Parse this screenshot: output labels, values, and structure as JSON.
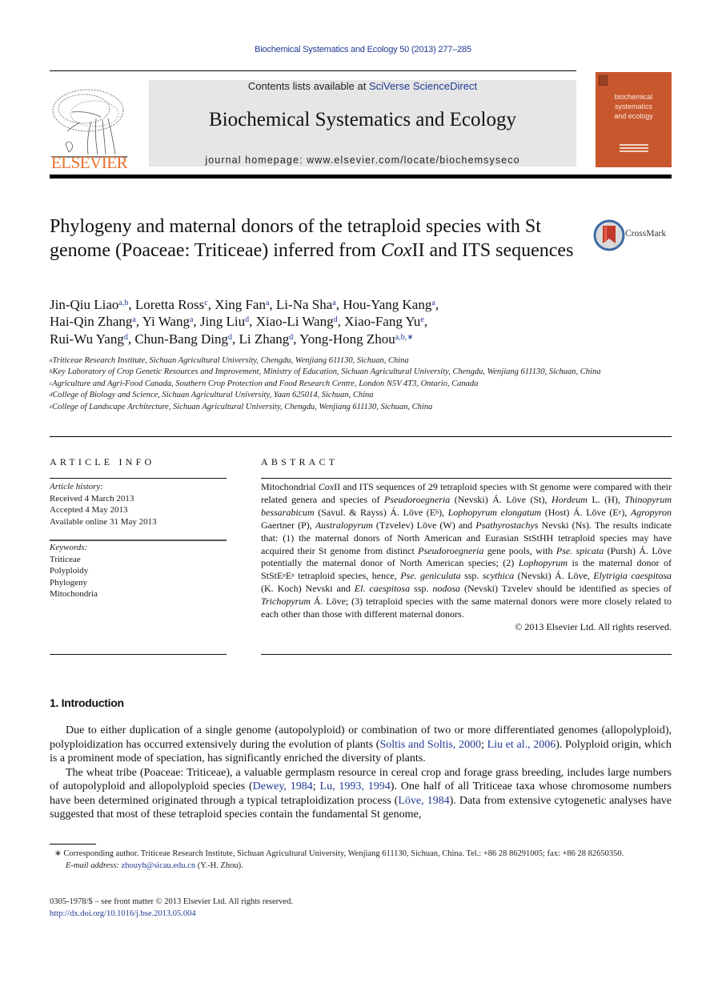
{
  "header": {
    "citation": "Biochemical Systematics and Ecology 50 (2013) 277–285",
    "publisher_logo_text": "ELSEVIER",
    "contents_prefix": "Contents lists available at ",
    "contents_link": "SciVerse ScienceDirect",
    "journal_title": "Biochemical Systematics and Ecology",
    "homepage_label": "journal homepage: www.elsevier.com/locate/biochemsyseco",
    "cover_title_lines": [
      "biochemical",
      "systematics",
      "and ecology"
    ],
    "brand_color": "#e8712c",
    "cover_color": "#c8572e",
    "link_color": "#1f3a93"
  },
  "article": {
    "title_part1": "Phylogeny and maternal donors of the tetraploid species with St genome (Poaceae: Triticeae) inferred from ",
    "title_italic": "Cox",
    "title_part2": "II and ITS sequences",
    "crossmark_label": "CrossMark",
    "authors": [
      {
        "name": "Jin-Qiu Liao",
        "aff": "a,b"
      },
      {
        "name": "Loretta Ross",
        "aff": "c"
      },
      {
        "name": "Xing Fan",
        "aff": "a"
      },
      {
        "name": "Li-Na Sha",
        "aff": "a"
      },
      {
        "name": "Hou-Yang Kang",
        "aff": "a"
      },
      {
        "name": "Hai-Qin Zhang",
        "aff": "a"
      },
      {
        "name": "Yi Wang",
        "aff": "a"
      },
      {
        "name": "Jing Liu",
        "aff": "d"
      },
      {
        "name": "Xiao-Li Wang",
        "aff": "d"
      },
      {
        "name": "Xiao-Fang Yu",
        "aff": "e"
      },
      {
        "name": "Rui-Wu Yang",
        "aff": "d"
      },
      {
        "name": "Chun-Bang Ding",
        "aff": "d"
      },
      {
        "name": "Li Zhang",
        "aff": "d"
      },
      {
        "name": "Yong-Hong Zhou",
        "aff": "a,b,∗"
      }
    ],
    "affiliations": [
      {
        "key": "a",
        "text": "Triticeae Research Institute, Sichuan Agricultural University, Chengdu, Wenjiang 611130, Sichuan, China"
      },
      {
        "key": "b",
        "text": "Key Laboratory of Crop Genetic Resources and Improvement, Ministry of Education, Sichuan Agricultural University, Chengdu, Wenjiang 611130, Sichuan, China"
      },
      {
        "key": "c",
        "text": "Agriculture and Agri-Food Canada, Southern Crop Protection and Food Research Centre, London N5V 4T3, Ontario, Canada"
      },
      {
        "key": "d",
        "text": "College of Biology and Science, Sichuan Agricultural University, Yaan 625014, Sichuan, China"
      },
      {
        "key": "e",
        "text": "College of Landscape Architecture, Sichuan Agricultural University, Chengdu, Wenjiang 611130, Sichuan, China"
      }
    ]
  },
  "article_info": {
    "heading": "ARTICLE INFO",
    "history_label": "Article history:",
    "received": "Received 4 March 2013",
    "accepted": "Accepted 4 May 2013",
    "online": "Available online 31 May 2013",
    "keywords_label": "Keywords:",
    "keywords": [
      "Triticeae",
      "Polyploidy",
      "Phylogeny",
      "Mitochondria"
    ]
  },
  "abstract": {
    "heading": "ABSTRACT",
    "segments": [
      {
        "t": "Mitochondrial "
      },
      {
        "t": "Cox",
        "i": true
      },
      {
        "t": "II and ITS sequences of 29 tetraploid species with St genome were compared with their related genera and species of "
      },
      {
        "t": "Pseudoroegneria",
        "i": true
      },
      {
        "t": " (Nevski) Á. Löve (St), "
      },
      {
        "t": "Hordeum",
        "i": true
      },
      {
        "t": " L. (H), "
      },
      {
        "t": "Thinopyrum bessarabicum",
        "i": true
      },
      {
        "t": " (Savul. & Rayss) Á. Löve (E"
      },
      {
        "t": "b",
        "sup": true
      },
      {
        "t": "), "
      },
      {
        "t": "Lophopyrum elongatum",
        "i": true
      },
      {
        "t": " (Host) Á. Löve (E"
      },
      {
        "t": "e",
        "sup": true
      },
      {
        "t": "), "
      },
      {
        "t": "Agropyron",
        "i": true
      },
      {
        "t": " Gaertner (P), "
      },
      {
        "t": "Australopyrum",
        "i": true
      },
      {
        "t": " (Tzvelev) Löve (W) and "
      },
      {
        "t": "Psathyrostachys",
        "i": true
      },
      {
        "t": " Nevski (Ns). The results indicate that: (1) the maternal donors of North American and Eurasian StStHH tetraploid species may have acquired their St genome from distinct "
      },
      {
        "t": "Pseudoroegneria",
        "i": true
      },
      {
        "t": " gene pools, with "
      },
      {
        "t": "Pse. spicata",
        "i": true
      },
      {
        "t": " (Pursh) Á. Löve potentially the maternal donor of North American species; (2) "
      },
      {
        "t": "Lophopyrum",
        "i": true
      },
      {
        "t": " is the maternal donor of StStE"
      },
      {
        "t": "e",
        "sup": true
      },
      {
        "t": "E"
      },
      {
        "t": "e",
        "sup": true
      },
      {
        "t": " tetraploid species, hence, "
      },
      {
        "t": "Pse. geniculata",
        "i": true
      },
      {
        "t": " ssp. "
      },
      {
        "t": "scythica",
        "i": true
      },
      {
        "t": " (Nevski) Á. Löve, "
      },
      {
        "t": "Elytrigia caespitosa",
        "i": true
      },
      {
        "t": " (K. Koch) Nevski and "
      },
      {
        "t": "El. caespitosa",
        "i": true
      },
      {
        "t": " ssp. "
      },
      {
        "t": "nodosa",
        "i": true
      },
      {
        "t": " (Nevski) Tzvelev should be identified as species of "
      },
      {
        "t": "Trichopyrum",
        "i": true
      },
      {
        "t": " Á. Löve; (3) tetraploid species with the same maternal donors were more closely related to each other than those with different maternal donors."
      }
    ],
    "copyright": "© 2013 Elsevier Ltd. All rights reserved."
  },
  "introduction": {
    "heading": "1.  Introduction",
    "paragraphs": [
      [
        {
          "t": "Due to either duplication of a single genome (autopolyploid) or combination of two or more differentiated genomes (allopolyploid), polyploidization has occurred extensively during the evolution of plants ("
        },
        {
          "t": "Soltis and Soltis, 2000",
          "link": true
        },
        {
          "t": "; "
        },
        {
          "t": "Liu et al., 2006",
          "link": true
        },
        {
          "t": "). Polyploid origin, which is a prominent mode of speciation, has significantly enriched the diversity of plants."
        }
      ],
      [
        {
          "t": "The wheat tribe (Poaceae: Triticeae), a valuable germplasm resource in cereal crop and forage grass breeding, includes large numbers of autopolyploid and allopolyploid species ("
        },
        {
          "t": "Dewey, 1984",
          "link": true
        },
        {
          "t": "; "
        },
        {
          "t": "Lu, 1993, 1994",
          "link": true
        },
        {
          "t": "). One half of all Triticeae taxa whose chromosome numbers have been determined originated through a typical tetraploidization process ("
        },
        {
          "t": "Löve, 1984",
          "link": true
        },
        {
          "t": "). Data from extensive cytogenetic analyses have suggested that most of these tetraploid species contain the fundamental St genome,"
        }
      ]
    ]
  },
  "footnotes": {
    "corresponding": "∗ Corresponding author. Triticeae Research Institute, Sichuan Agricultural University, Wenjiang 611130, Sichuan, China. Tel.: +86 28 86291005; fax: +86 28 82650350.",
    "email_label": "E-mail address:",
    "email": "zhouyh@sicau.edu.cn",
    "email_suffix": " (Y.-H. Zhou).",
    "issn": "0305-1978/$ – see front matter © 2013 Elsevier Ltd. All rights reserved.",
    "doi": "http://dx.doi.org/10.1016/j.bse.2013.05.004"
  }
}
